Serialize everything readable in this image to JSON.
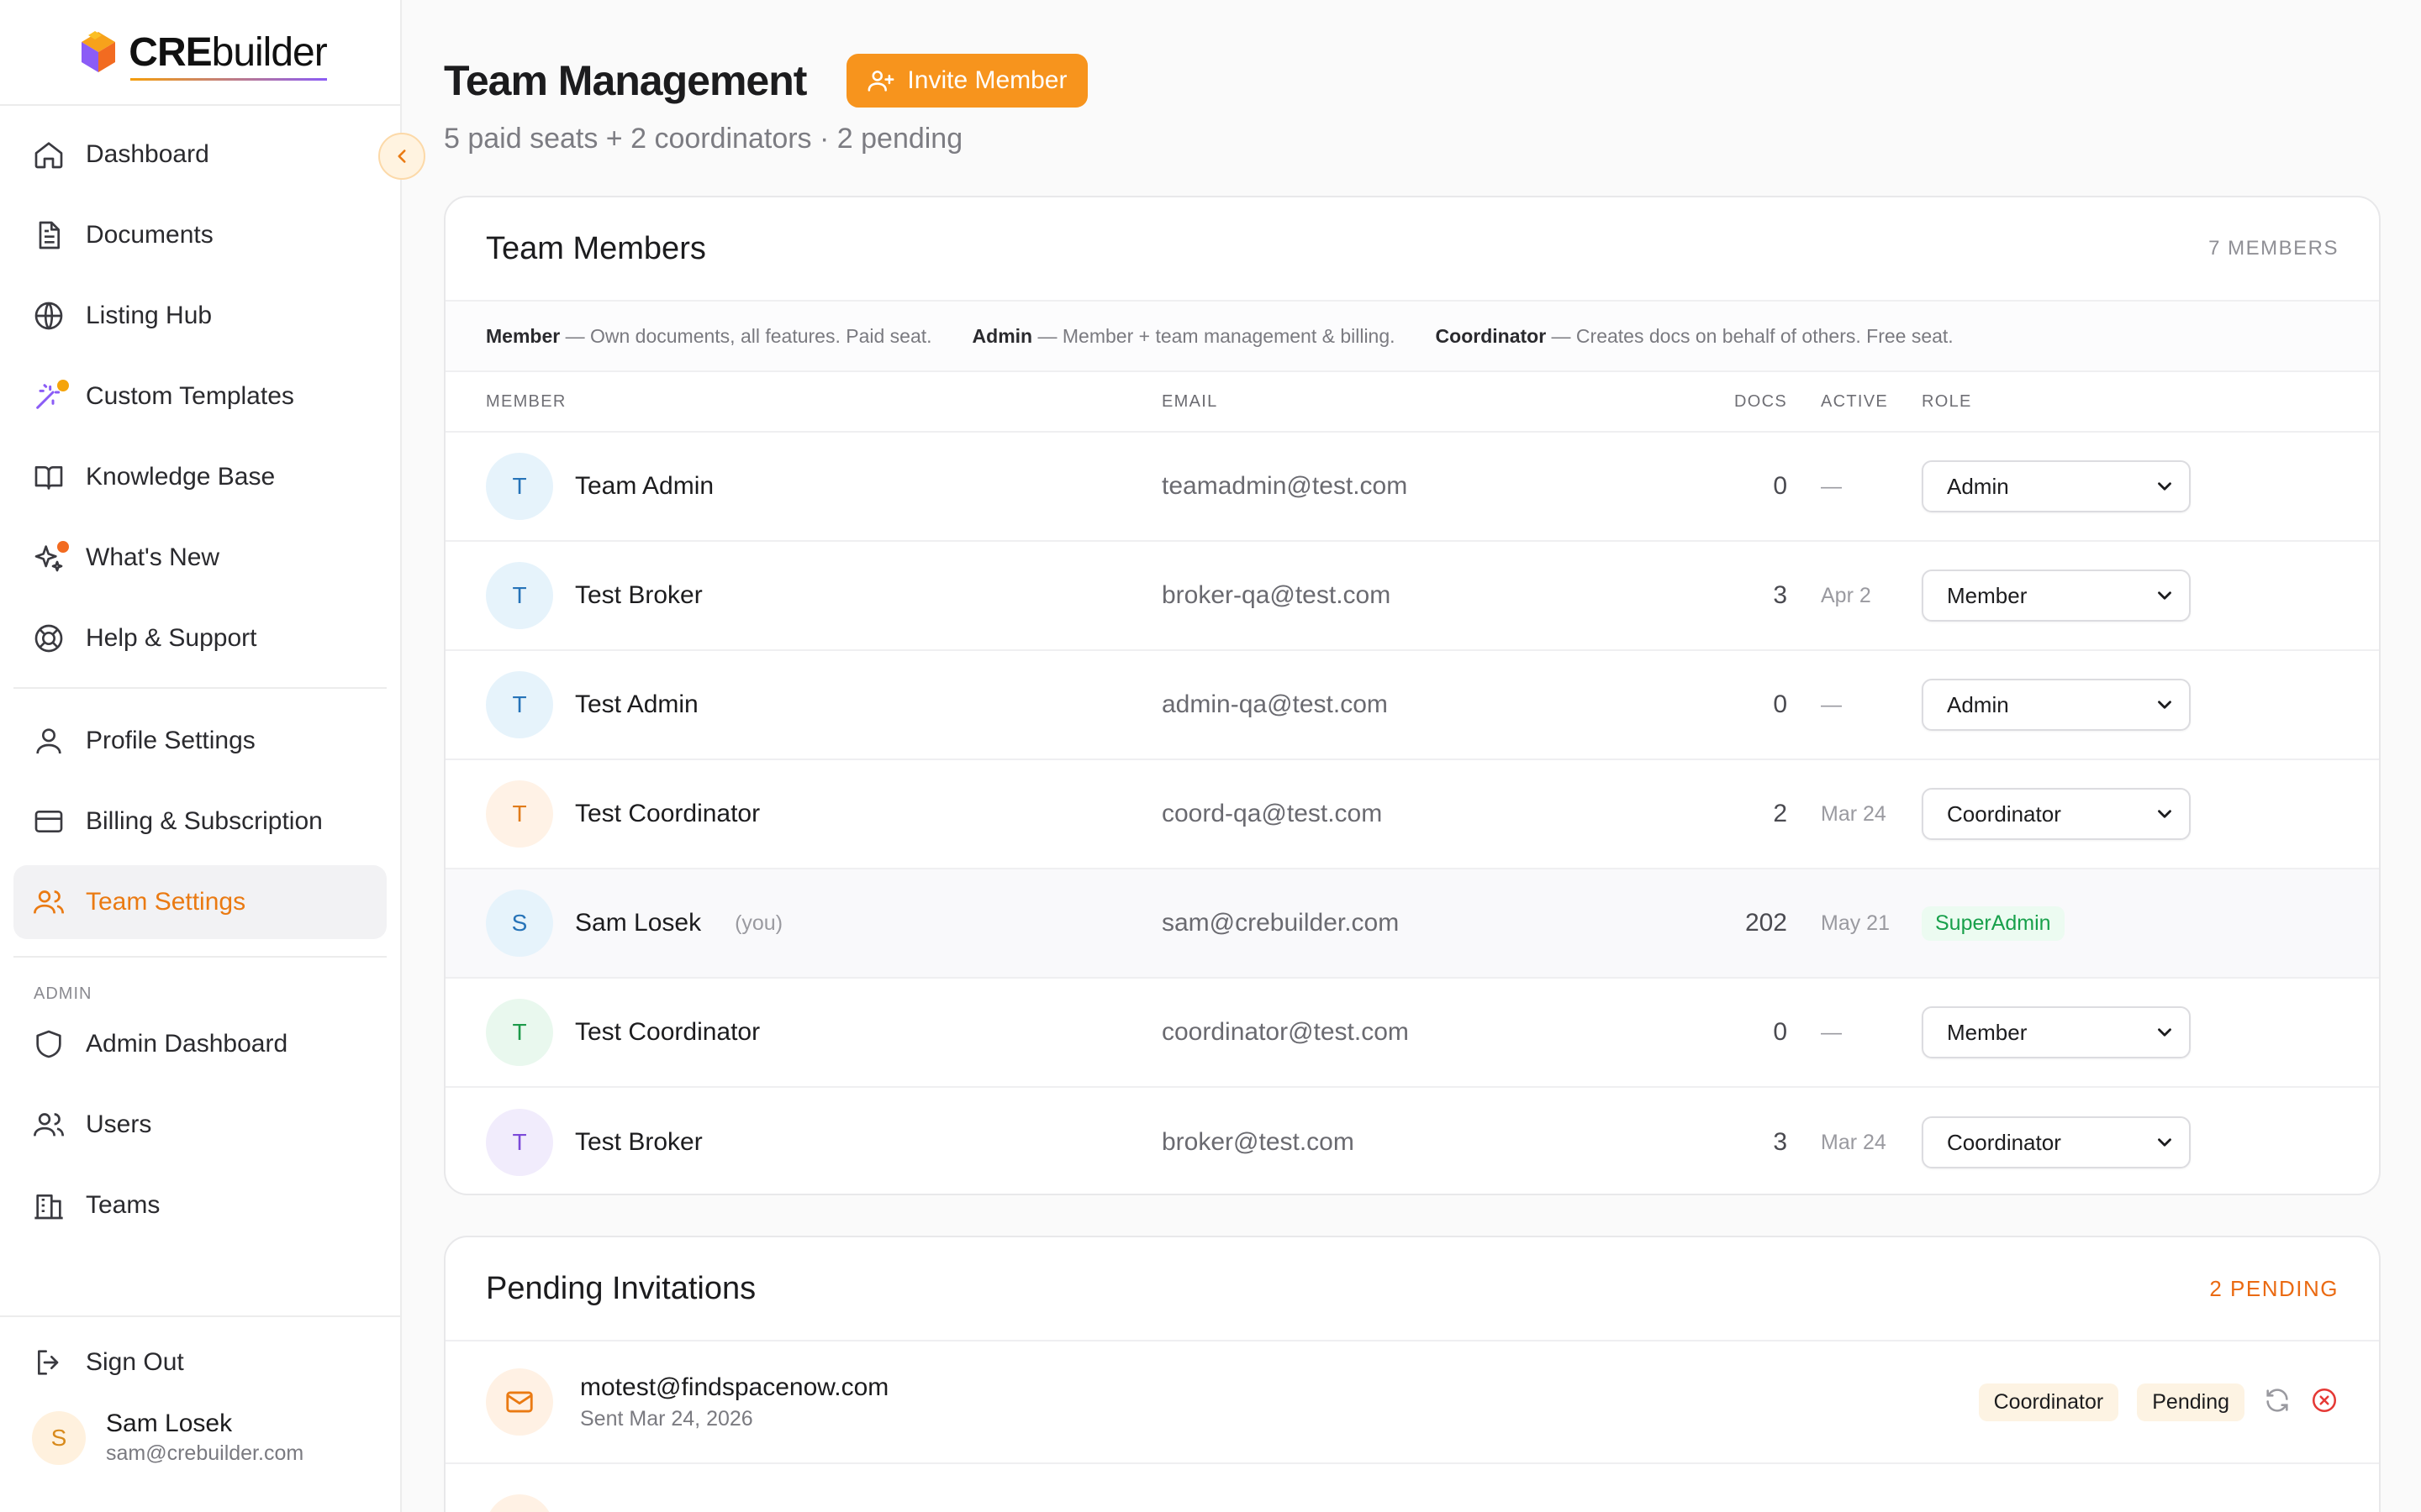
{
  "brand": {
    "bold": "CRE",
    "light": "builder"
  },
  "colors": {
    "accent": "#f7941d",
    "active": "#ea7a12",
    "superadmin": "#18a04b",
    "danger": "#e53935"
  },
  "sidebar": {
    "main": [
      {
        "label": "Dashboard",
        "icon": "home-icon"
      },
      {
        "label": "Documents",
        "icon": "document-icon"
      },
      {
        "label": "Listing Hub",
        "icon": "globe-icon"
      },
      {
        "label": "Custom Templates",
        "icon": "magic-wand-icon"
      },
      {
        "label": "Knowledge Base",
        "icon": "book-icon"
      },
      {
        "label": "What's New",
        "icon": "sparkles-icon"
      },
      {
        "label": "Help & Support",
        "icon": "lifebuoy-icon"
      }
    ],
    "settings": [
      {
        "label": "Profile Settings",
        "icon": "user-icon"
      },
      {
        "label": "Billing & Subscription",
        "icon": "credit-card-icon"
      },
      {
        "label": "Team Settings",
        "icon": "users-icon"
      }
    ],
    "admin_label": "ADMIN",
    "admin": [
      {
        "label": "Admin Dashboard",
        "icon": "shield-icon"
      },
      {
        "label": "Users",
        "icon": "users-icon"
      },
      {
        "label": "Teams",
        "icon": "building-icon"
      }
    ],
    "sign_out": "Sign Out",
    "user": {
      "initial": "S",
      "name": "Sam Losek",
      "email": "sam@crebuilder.com"
    }
  },
  "header": {
    "title": "Team Management",
    "invite_label": "Invite Member",
    "subtitle": "5 paid seats + 2 coordinators · 2 pending"
  },
  "members_card": {
    "title": "Team Members",
    "count": "7 MEMBERS",
    "legend": [
      {
        "role": "Member",
        "desc": " — Own documents, all features. Paid seat."
      },
      {
        "role": "Admin",
        "desc": " — Member + team management & billing."
      },
      {
        "role": "Coordinator",
        "desc": " — Creates docs on behalf of others. Free seat."
      }
    ],
    "columns": {
      "member": "MEMBER",
      "email": "EMAIL",
      "docs": "DOCS",
      "active": "ACTIVE",
      "role": "ROLE"
    },
    "rows": [
      {
        "initial": "T",
        "name": "Team Admin",
        "you": "",
        "email": "teamadmin@test.com",
        "docs": "0",
        "active": "—",
        "role": "Admin",
        "avatar_bg": "#e6f3fb",
        "avatar_fg": "#2673b8"
      },
      {
        "initial": "T",
        "name": "Test Broker",
        "you": "",
        "email": "broker-qa@test.com",
        "docs": "3",
        "active": "Apr 2",
        "role": "Member",
        "avatar_bg": "#e6f3fb",
        "avatar_fg": "#2673b8"
      },
      {
        "initial": "T",
        "name": "Test Admin",
        "you": "",
        "email": "admin-qa@test.com",
        "docs": "0",
        "active": "—",
        "role": "Admin",
        "avatar_bg": "#e6f3fb",
        "avatar_fg": "#2673b8"
      },
      {
        "initial": "T",
        "name": "Test Coordinator",
        "you": "",
        "email": "coord-qa@test.com",
        "docs": "2",
        "active": "Mar 24",
        "role": "Coordinator",
        "avatar_bg": "#fff2e6",
        "avatar_fg": "#e07b1a"
      },
      {
        "initial": "S",
        "name": "Sam Losek",
        "you": "(you)",
        "email": "sam@crebuilder.com",
        "docs": "202",
        "active": "May 21",
        "role": "SuperAdmin",
        "avatar_bg": "#e6f3fb",
        "avatar_fg": "#2673b8"
      },
      {
        "initial": "T",
        "name": "Test Coordinator",
        "you": "",
        "email": "coordinator@test.com",
        "docs": "0",
        "active": "—",
        "role": "Member",
        "avatar_bg": "#e9f8ee",
        "avatar_fg": "#1d9a4a"
      },
      {
        "initial": "T",
        "name": "Test Broker",
        "you": "",
        "email": "broker@test.com",
        "docs": "3",
        "active": "Mar 24",
        "role": "Coordinator",
        "avatar_bg": "#f1ecfc",
        "avatar_fg": "#7c4ad8"
      }
    ]
  },
  "pending_card": {
    "title": "Pending Invitations",
    "count": "2 PENDING",
    "invites": [
      {
        "email": "motest@findspacenow.com",
        "sent": "Sent Mar 24, 2026",
        "role": "Coordinator",
        "status": "Pending"
      }
    ]
  }
}
